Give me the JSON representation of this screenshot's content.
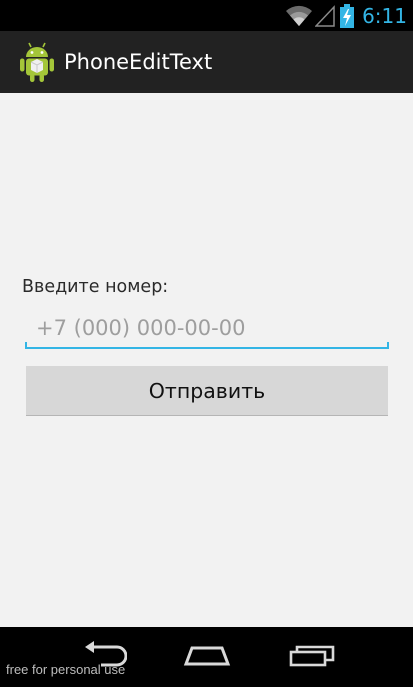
{
  "status_bar": {
    "time": "6:11",
    "icons": [
      "wifi-icon",
      "signal-icon",
      "battery-charging-icon"
    ],
    "accent_color": "#33b5e5"
  },
  "action_bar": {
    "icon": "android-robot-icon",
    "title": "PhoneEditText"
  },
  "form": {
    "label": "Введите номер:",
    "phone_placeholder": "+7 (000) 000-00-00",
    "phone_value": "",
    "submit_label": "Отправить"
  },
  "nav_bar": {
    "buttons": [
      "back-icon",
      "home-icon",
      "recent-apps-icon"
    ]
  },
  "watermark": "free for personal use"
}
